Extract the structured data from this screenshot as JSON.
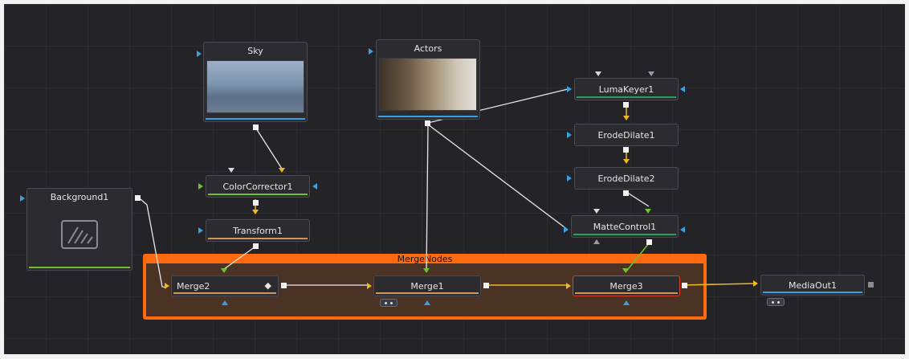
{
  "group": {
    "title": "MergeNodes"
  },
  "nodes": {
    "sky": "Sky",
    "actors": "Actors",
    "lumakeyer": "LumaKeyer1",
    "erode1": "ErodeDilate1",
    "erode2": "ErodeDilate2",
    "colorcorrector": "ColorCorrector1",
    "transform": "Transform1",
    "background": "Background1",
    "mattecontrol": "MatteControl1",
    "merge2": "Merge2",
    "merge1": "Merge1",
    "merge3": "Merge3",
    "mediaout": "MediaOut1"
  },
  "colors": {
    "canvas": "#232328",
    "group_border": "#ff6a10",
    "group_fill": "#4a3324",
    "wire_white": "#e8e8e8",
    "wire_yellow": "#f0b820",
    "wire_green": "#70c030",
    "port_blue": "#3aa0e0",
    "selected_outline": "#e0402a"
  }
}
